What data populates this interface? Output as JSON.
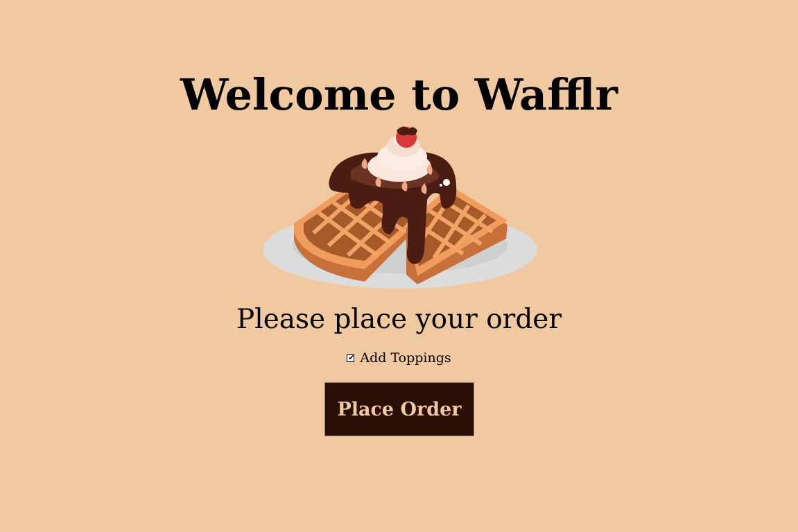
{
  "header": {
    "title": "Welcome to Wafflr"
  },
  "hero": {
    "icon": "waffle-with-chocolate-and-cream-illustration"
  },
  "order": {
    "prompt": "Please place your order",
    "toppings_label": "Add Toppings",
    "toppings_checked": true,
    "button_label": "Place Order"
  },
  "colors": {
    "background": "#f0c9a0",
    "button_bg": "#2a0f07",
    "button_text": "#f0c9a0"
  }
}
